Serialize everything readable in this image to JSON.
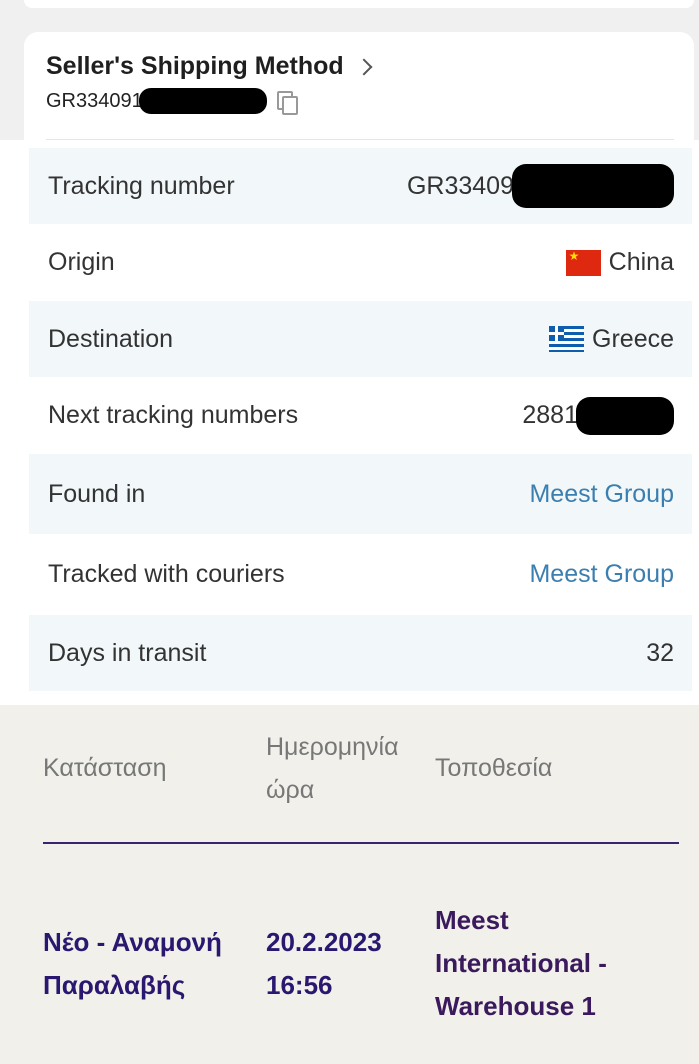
{
  "seller": {
    "title": "Seller's Shipping Method",
    "tracking_prefix": "GR334091"
  },
  "details": {
    "tracking_number": {
      "label": "Tracking number",
      "value": "GR33409"
    },
    "origin": {
      "label": "Origin",
      "value": "China",
      "flag": "china-flag-icon"
    },
    "destination": {
      "label": "Destination",
      "value": "Greece",
      "flag": "greece-flag-icon"
    },
    "next_tracking": {
      "label": "Next tracking numbers",
      "value": "2881"
    },
    "found_in": {
      "label": "Found in",
      "value": "Meest Group"
    },
    "tracked_with": {
      "label": "Tracked with couriers",
      "value": "Meest Group"
    },
    "days_in_transit": {
      "label": "Days in transit",
      "value": "32"
    }
  },
  "history": {
    "headers": {
      "status": "Κατάσταση",
      "date_line1": "Ημερομηνία",
      "date_line2": "ώρα",
      "location": "Τοποθεσία"
    },
    "row": {
      "status_line1": "Νέο - Αναμονή",
      "status_line2": "Παραλαβής",
      "date": "20.2.2023",
      "time": "16:56",
      "location_line1": "Meest",
      "location_line2": "International -",
      "location_line3": "Warehouse 1"
    }
  },
  "colors": {
    "link": "#3b7fb0",
    "status_text": "#2a1870",
    "location_text": "#3a1a5c",
    "header_rule": "#3a2470"
  }
}
